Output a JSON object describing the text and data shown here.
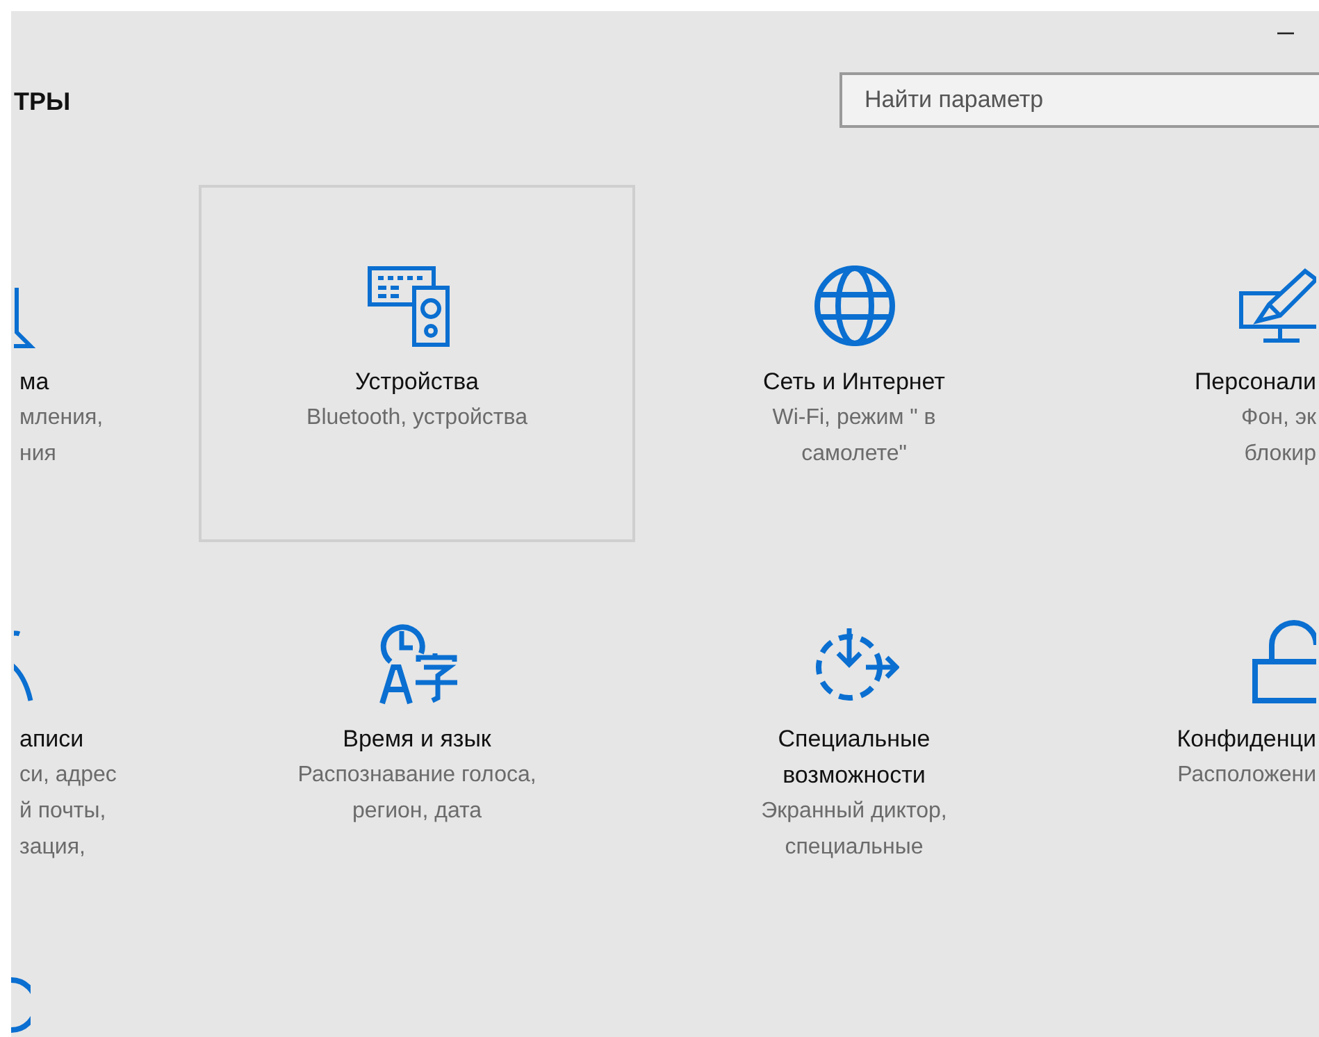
{
  "header": {
    "title": "ТРЫ",
    "search": {
      "placeholder": "Найти параметр"
    }
  },
  "tiles": [
    {
      "title": "ма",
      "lines": [
        "мления,",
        "ния"
      ],
      "selected": false
    },
    {
      "title": "Устройства",
      "lines": [
        "Bluetooth, устройства"
      ],
      "selected": true
    },
    {
      "title": "Сеть и Интернет",
      "lines": [
        "Wi-Fi, режим \" в",
        "самолете\""
      ],
      "selected": false
    },
    {
      "title": "Персонали",
      "lines": [
        "Фон, эк",
        "блокир"
      ],
      "selected": false
    },
    {
      "title": "аписи",
      "lines": [
        "си, адрес",
        "й почты,",
        "зация,"
      ],
      "selected": false
    },
    {
      "title": "Время и язык",
      "lines": [
        "Распознавание голоса,",
        "регион, дата"
      ],
      "selected": false
    },
    {
      "title": "Специальные возможности",
      "lines": [
        "Экранный диктор,",
        "специальные"
      ],
      "selected": false
    },
    {
      "title": "Конфиденци",
      "lines": [
        "Расположени"
      ],
      "selected": false
    }
  ]
}
